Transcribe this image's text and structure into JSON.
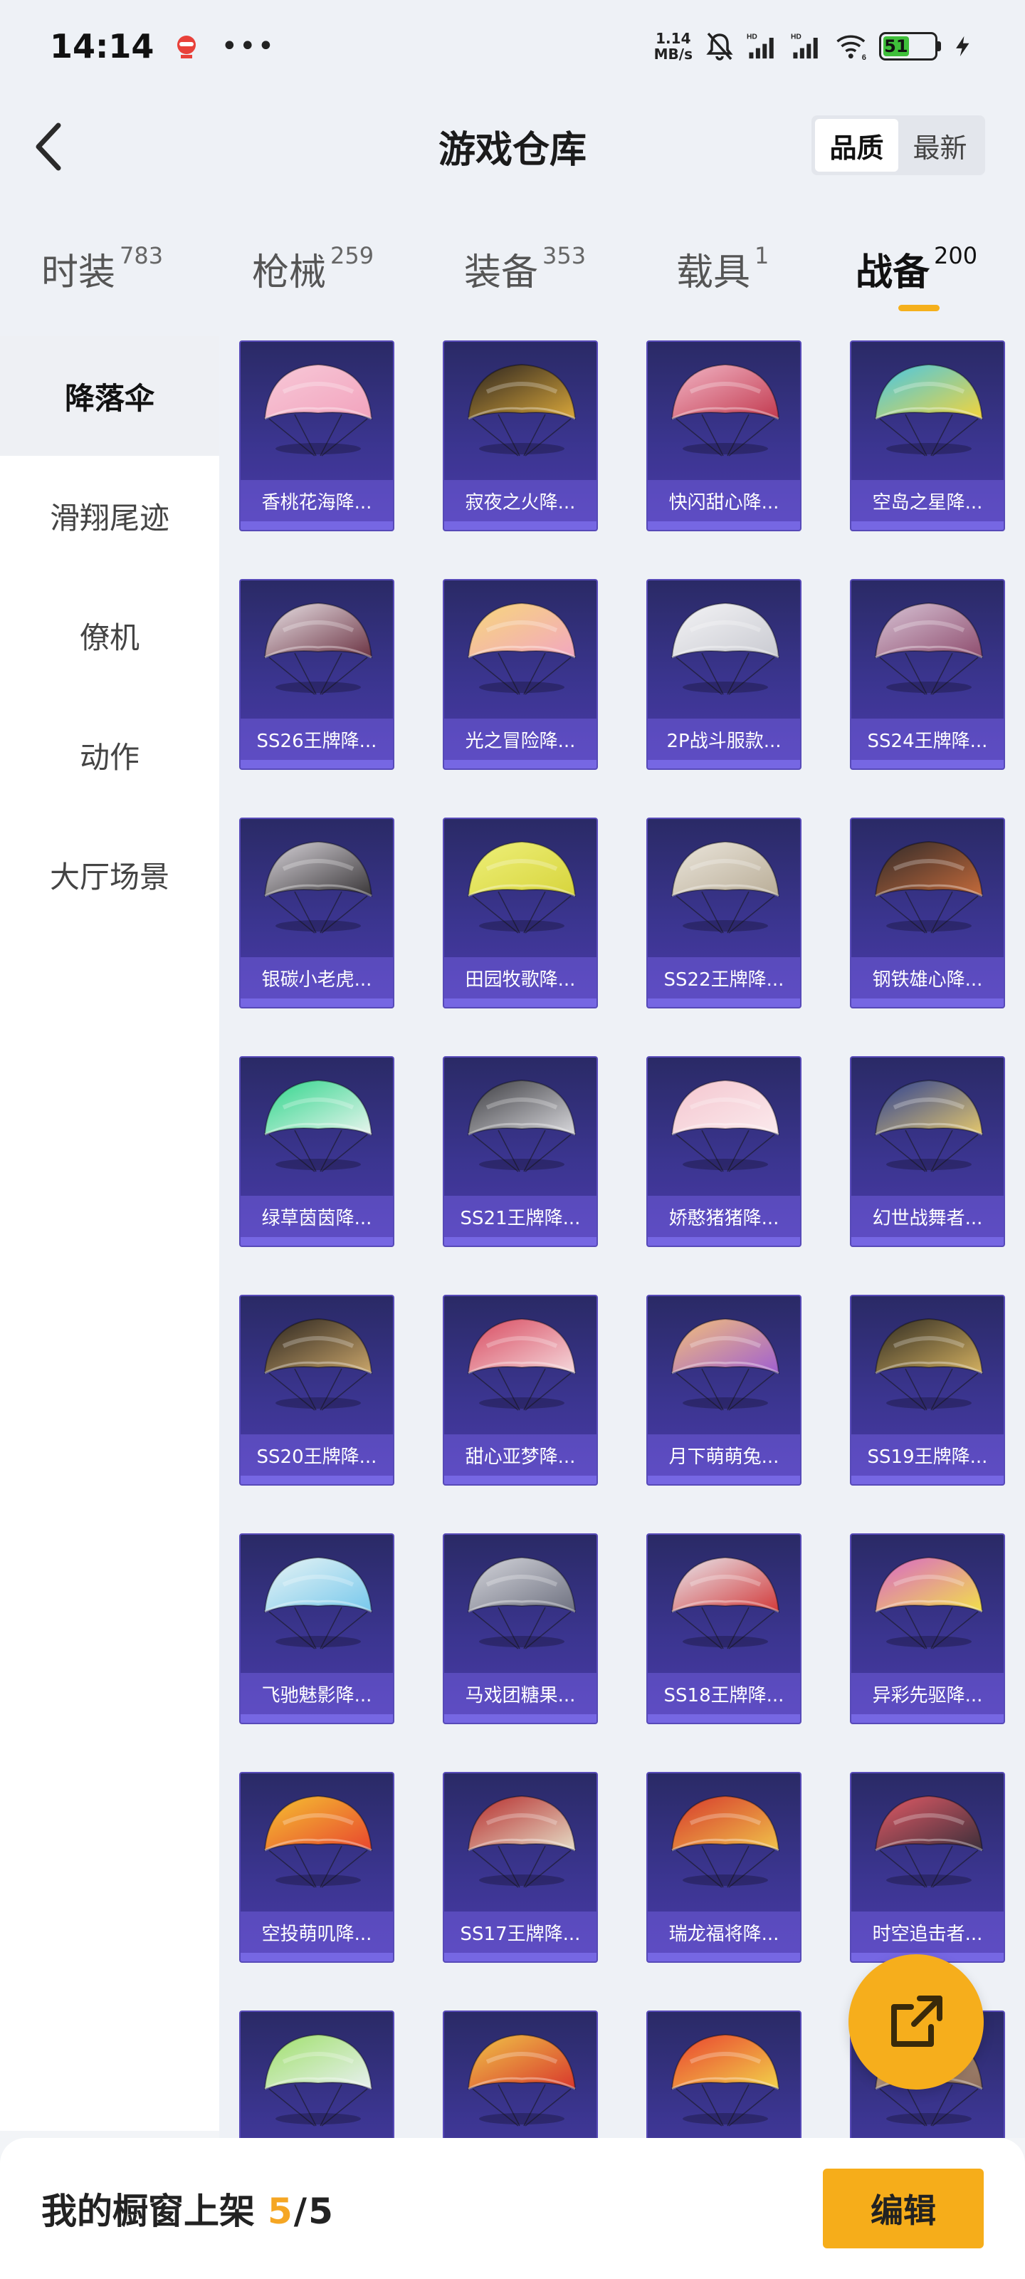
{
  "status": {
    "time": "14:14",
    "net_speed_value": "1.14",
    "net_speed_unit": "MB/s",
    "battery": "51",
    "battery_level": 0.51,
    "wifi_label": "6",
    "hd_label": "HD"
  },
  "header": {
    "title": "游戏仓库",
    "sort_options": [
      "品质",
      "最新"
    ],
    "active_sort": "品质"
  },
  "tabs": [
    {
      "label": "时装",
      "count": "783"
    },
    {
      "label": "枪械",
      "count": "259"
    },
    {
      "label": "装备",
      "count": "353"
    },
    {
      "label": "载具",
      "count": "1"
    },
    {
      "label": "战备",
      "count": "200",
      "active": true
    }
  ],
  "sidebar": {
    "items": [
      "降落伞",
      "滑翔尾迹",
      "僚机",
      "动作",
      "大厅场景"
    ],
    "active": "降落伞"
  },
  "items": [
    {
      "name": "香桃花海降...",
      "colors": [
        "#f7c9d8",
        "#f2a3bd"
      ]
    },
    {
      "name": "寂夜之火降...",
      "colors": [
        "#2a2320",
        "#d9a73a"
      ]
    },
    {
      "name": "快闪甜心降...",
      "colors": [
        "#f2b6c6",
        "#c23a4f"
      ]
    },
    {
      "name": "空岛之星降...",
      "colors": [
        "#45c7e8",
        "#f3d43b"
      ]
    },
    {
      "name": "SS26王牌降...",
      "colors": [
        "#e9e2e6",
        "#6b3343"
      ]
    },
    {
      "name": "光之冒险降...",
      "colors": [
        "#f7d77b",
        "#f2a7c0"
      ]
    },
    {
      "name": "2P战斗服款...",
      "colors": [
        "#f4f4f6",
        "#c9cad1"
      ]
    },
    {
      "name": "SS24王牌降...",
      "colors": [
        "#d8c4d6",
        "#8e4d6e"
      ]
    },
    {
      "name": "银碳小老虎...",
      "colors": [
        "#d7d3d9",
        "#393638"
      ]
    },
    {
      "name": "田园牧歌降...",
      "colors": [
        "#eef07a",
        "#d7d43c"
      ]
    },
    {
      "name": "SS22王牌降...",
      "colors": [
        "#ebe6dc",
        "#b9ad97"
      ]
    },
    {
      "name": "钢铁雄心降...",
      "colors": [
        "#2f2a2a",
        "#c46a3a"
      ]
    },
    {
      "name": "绿草茵茵降...",
      "colors": [
        "#2fd58b",
        "#e8f5ee"
      ]
    },
    {
      "name": "SS21王牌降...",
      "colors": [
        "#3b3b40",
        "#d8d8dc"
      ]
    },
    {
      "name": "娇憨猪猪降...",
      "colors": [
        "#f4c6cf",
        "#fbeaed"
      ]
    },
    {
      "name": "幻世战舞者...",
      "colors": [
        "#2b3f93",
        "#e4c76c"
      ]
    },
    {
      "name": "SS20王牌降...",
      "colors": [
        "#2a241f",
        "#c9a56a"
      ]
    },
    {
      "name": "甜心亚梦降...",
      "colors": [
        "#d84a5f",
        "#f5d8dc"
      ]
    },
    {
      "name": "月下萌萌兔...",
      "colors": [
        "#f3c07a",
        "#a05fd0"
      ]
    },
    {
      "name": "SS19王牌降...",
      "colors": [
        "#2e2a22",
        "#d3b060"
      ]
    },
    {
      "name": "飞驰魅影降...",
      "colors": [
        "#e8f4f5",
        "#77c8ec"
      ]
    },
    {
      "name": "马戏团糖果...",
      "colors": [
        "#d5d6dc",
        "#6e7180"
      ]
    },
    {
      "name": "SS18王牌降...",
      "colors": [
        "#e8e8ee",
        "#d23a3a"
      ]
    },
    {
      "name": "异彩先驱降...",
      "colors": [
        "#d866c9",
        "#f2e04a"
      ]
    },
    {
      "name": "空投萌叽降...",
      "colors": [
        "#f5c232",
        "#e8462e"
      ]
    },
    {
      "name": "SS17王牌降...",
      "colors": [
        "#b62c2c",
        "#e5dcc6"
      ]
    },
    {
      "name": "瑞龙福将降...",
      "colors": [
        "#d6382c",
        "#f0c24a"
      ]
    },
    {
      "name": "时空追击者...",
      "colors": [
        "#e25a66",
        "#3b2f3a"
      ]
    },
    {
      "name": "",
      "colors": [
        "#9fe06a",
        "#e8f0f0"
      ]
    },
    {
      "name": "",
      "colors": [
        "#f0c548",
        "#d8372c"
      ]
    },
    {
      "name": "",
      "colors": [
        "#e9412f",
        "#f2d24a"
      ]
    },
    {
      "name": "",
      "colors": [
        "#d8b99a",
        "#8b6b5a"
      ]
    }
  ],
  "showcase": {
    "label": "我的橱窗上架",
    "current": "5",
    "separator": "/",
    "total": "5"
  },
  "edit_label": "编辑",
  "accent_color": "#f6ad1a"
}
